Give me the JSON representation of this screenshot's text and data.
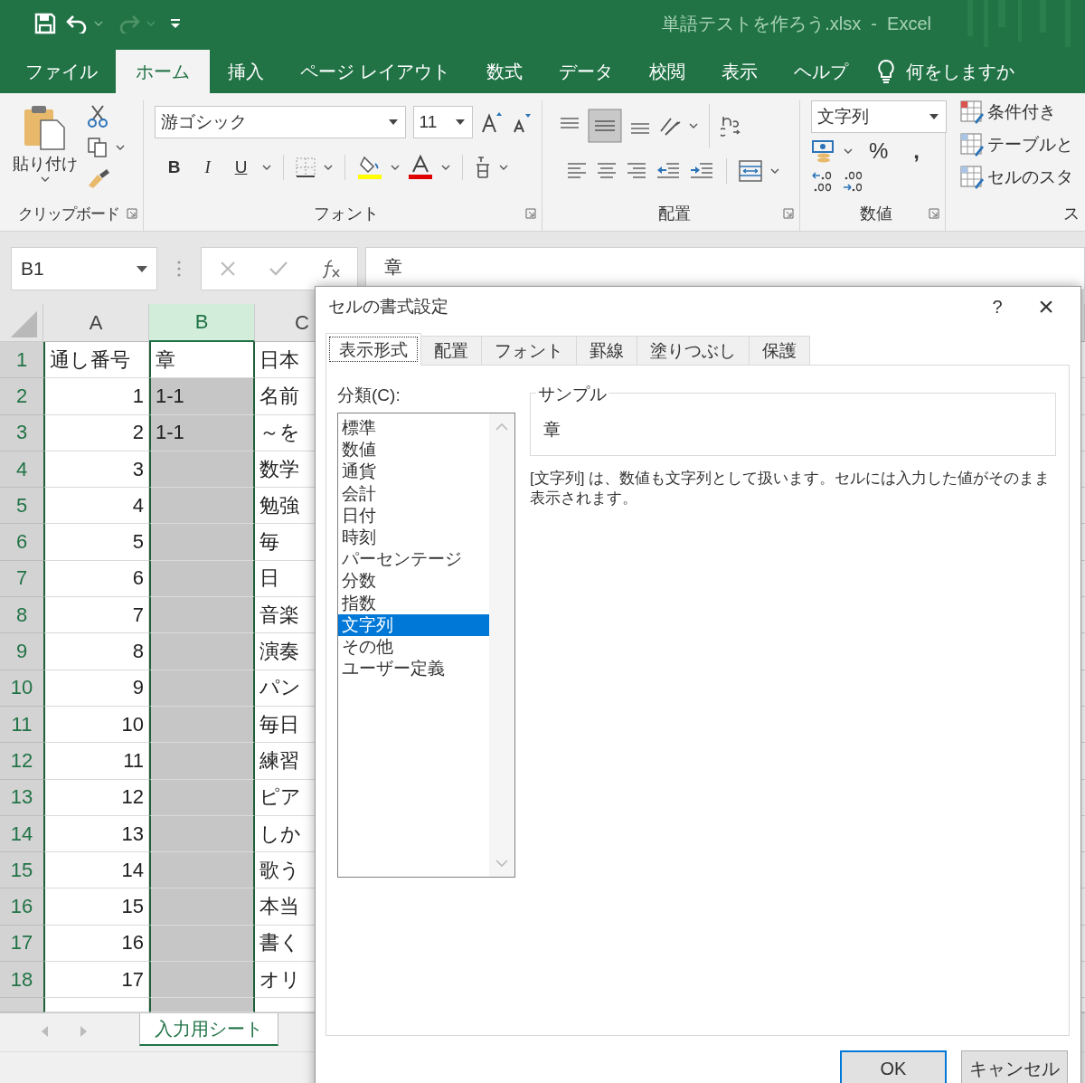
{
  "title_bar": {
    "title": "単語テストを作ろう.xlsx  -  Excel"
  },
  "ribbon_tabs": [
    {
      "label": "ファイル",
      "selected": false
    },
    {
      "label": "ホーム",
      "selected": true
    },
    {
      "label": "挿入",
      "selected": false
    },
    {
      "label": "ページ レイアウト",
      "selected": false
    },
    {
      "label": "数式",
      "selected": false
    },
    {
      "label": "データ",
      "selected": false
    },
    {
      "label": "校閲",
      "selected": false
    },
    {
      "label": "表示",
      "selected": false
    },
    {
      "label": "ヘルプ",
      "selected": false
    }
  ],
  "tell_me": "何をしますか",
  "ribbon": {
    "clipboard": {
      "paste": "貼り付け",
      "label": "クリップボード"
    },
    "font": {
      "name": "游ゴシック",
      "size": "11",
      "bold": "B",
      "italic": "I",
      "underline": "U",
      "label": "フォント"
    },
    "alignment": {
      "label": "配置"
    },
    "number": {
      "format": "文字列",
      "percent": "%",
      "comma": ",",
      "label": "数値"
    },
    "styles": {
      "items": [
        "条件付き",
        "テーブルと",
        "セルのスタ"
      ],
      "label": "ス"
    }
  },
  "formula_bar": {
    "name_box": "B1",
    "value": "章"
  },
  "sheet": {
    "columns": [
      {
        "label": "A",
        "selected": false
      },
      {
        "label": "B",
        "selected": true
      },
      {
        "label": "C",
        "selected": false
      }
    ],
    "rows": [
      {
        "number": "1",
        "a": "通し番号",
        "b": "章",
        "c": "日本",
        "b_selected": false
      },
      {
        "number": "2",
        "a": "1",
        "b": "1-1",
        "c": "名前",
        "b_selected": true
      },
      {
        "number": "3",
        "a": "2",
        "b": "1-1",
        "c": "～を",
        "b_selected": true
      },
      {
        "number": "4",
        "a": "3",
        "b": "",
        "c": "数学",
        "b_selected": true
      },
      {
        "number": "5",
        "a": "4",
        "b": "",
        "c": "勉強",
        "b_selected": true
      },
      {
        "number": "6",
        "a": "5",
        "b": "",
        "c": "毎",
        "b_selected": true
      },
      {
        "number": "7",
        "a": "6",
        "b": "",
        "c": "日",
        "b_selected": true
      },
      {
        "number": "8",
        "a": "7",
        "b": "",
        "c": "音楽",
        "b_selected": true
      },
      {
        "number": "9",
        "a": "8",
        "b": "",
        "c": "演奏",
        "b_selected": true
      },
      {
        "number": "10",
        "a": "9",
        "b": "",
        "c": "パン",
        "b_selected": true
      },
      {
        "number": "11",
        "a": "10",
        "b": "",
        "c": "毎日",
        "b_selected": true
      },
      {
        "number": "12",
        "a": "11",
        "b": "",
        "c": "練習",
        "b_selected": true
      },
      {
        "number": "13",
        "a": "12",
        "b": "",
        "c": "ピア",
        "b_selected": true
      },
      {
        "number": "14",
        "a": "13",
        "b": "",
        "c": "しか",
        "b_selected": true
      },
      {
        "number": "15",
        "a": "14",
        "b": "",
        "c": "歌う",
        "b_selected": true
      },
      {
        "number": "16",
        "a": "15",
        "b": "",
        "c": "本当",
        "b_selected": true
      },
      {
        "number": "17",
        "a": "16",
        "b": "",
        "c": "書く",
        "b_selected": true
      },
      {
        "number": "18",
        "a": "17",
        "b": "",
        "c": "オリ",
        "b_selected": true
      }
    ],
    "sheet_tabs": [
      {
        "label": "入力用シート",
        "selected": true
      }
    ]
  },
  "dialog": {
    "title": "セルの書式設定",
    "help": "?",
    "close": "×",
    "tabs": [
      {
        "label": "表示形式",
        "selected": true
      },
      {
        "label": "配置",
        "selected": false
      },
      {
        "label": "フォント",
        "selected": false
      },
      {
        "label": "罫線",
        "selected": false
      },
      {
        "label": "塗りつぶし",
        "selected": false
      },
      {
        "label": "保護",
        "selected": false
      }
    ],
    "category_label": "分類(C):",
    "categories": [
      {
        "label": "標準",
        "selected": false
      },
      {
        "label": "数値",
        "selected": false
      },
      {
        "label": "通貨",
        "selected": false
      },
      {
        "label": "会計",
        "selected": false
      },
      {
        "label": "日付",
        "selected": false
      },
      {
        "label": "時刻",
        "selected": false
      },
      {
        "label": "パーセンテージ",
        "selected": false
      },
      {
        "label": "分数",
        "selected": false
      },
      {
        "label": "指数",
        "selected": false
      },
      {
        "label": "文字列",
        "selected": true
      },
      {
        "label": "その他",
        "selected": false
      },
      {
        "label": "ユーザー定義",
        "selected": false
      }
    ],
    "sample_label": "サンプル",
    "sample_value": "章",
    "description": "[文字列] は、数値も文字列として扱います。セルには入力した値がそのまま表示されます。",
    "buttons": [
      {
        "label": "OK",
        "default": true
      },
      {
        "label": "キャンセル",
        "default": false
      }
    ]
  }
}
